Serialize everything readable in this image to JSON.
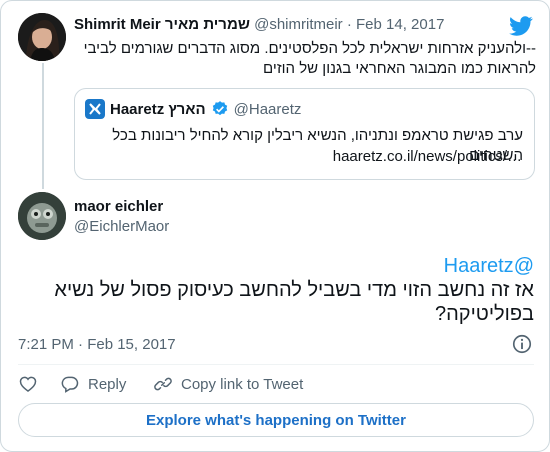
{
  "original_tweet": {
    "name": "Shimrit Meir שמרית מאיר",
    "handle": "@shimritmeir",
    "separator": "·",
    "date": "Feb 14, 2017",
    "text_line1": "--ולהעניק אזרחות ישראלית לכל הפלסטינים. מסוג הדברים שגורמים לביבי",
    "text_line2": "להראות כמו המבוגר האחראי בגנון של הוזים"
  },
  "quoted_tweet": {
    "name": "Haaretz הארץ",
    "handle": "@Haaretz",
    "text": "ערב פגישת טראמפ ונתניהו, הנשיא ריבלין קורא להחיל ריבונות בכל השטחים",
    "link": "haaretz.co.il/news/politics/…"
  },
  "reply_tweet": {
    "name": "maor eichler",
    "handle": "@EichlerMaor",
    "mention": "@Haaretz",
    "text": "אז זה נחשב הזוי מדי בשביל להחשב כעיסוק פסול של נשיא בפוליטיקה?",
    "timestamp": "7:21 PM · Feb 15, 2017"
  },
  "actions": {
    "reply_label": "Reply",
    "copy_label": "Copy link to Tweet"
  },
  "explore_label": "Explore what's happening on Twitter",
  "icons": {
    "brand": "twitter-bird-icon",
    "verified": "verified-badge-icon",
    "info": "info-icon",
    "like": "heart-icon",
    "reply": "reply-bubble-icon",
    "copy": "link-icon"
  },
  "colors": {
    "accent": "#1d9bf0",
    "muted": "#536471",
    "border": "#cfd9de",
    "haaretz": "#1a78c9"
  }
}
